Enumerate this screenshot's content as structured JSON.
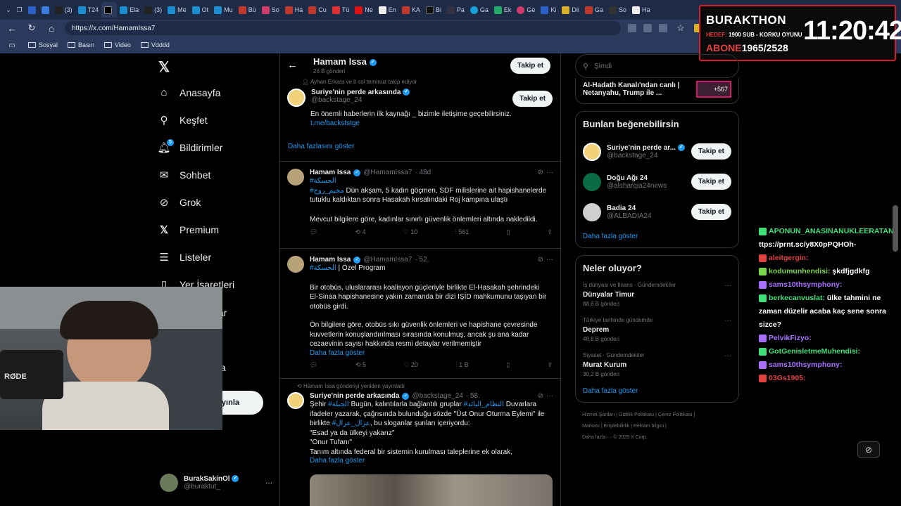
{
  "browser": {
    "tabs": [
      "(3)",
      "T24",
      "",
      "Ela",
      "(3)",
      "Me",
      "Ot",
      "Mu",
      "Bü",
      "So",
      "Ha",
      "Cu",
      "Tü",
      "Ne",
      "En",
      "KA",
      "Bi",
      "Pa",
      "Ga",
      "Ek",
      "Ge",
      "Ki",
      "Dii",
      "Ga",
      "So",
      "Ha"
    ],
    "url": "https://x.com/HamamIssa7",
    "bookmarks": [
      "Sosyal",
      "Basın",
      "Video",
      "Vdddd"
    ]
  },
  "stream": {
    "name": "BURAKTHON",
    "hedef_label": "HEDEF:",
    "hedef": "1900 SUB - KORKU OYUNU",
    "abone_label": "ABONE",
    "abone": "1965/2528",
    "clock": "11:20:42"
  },
  "nav": {
    "items": [
      {
        "label": "Anasayfa",
        "icon": "home-icon"
      },
      {
        "label": "Keşfet",
        "icon": "search-icon"
      },
      {
        "label": "Bildirimler",
        "icon": "bell-icon",
        "badge": "5"
      },
      {
        "label": "Sohbet",
        "icon": "mail-icon"
      },
      {
        "label": "Grok",
        "icon": "grok-icon"
      },
      {
        "label": "Premium",
        "icon": "x-icon"
      },
      {
        "label": "Listeler",
        "icon": "list-icon"
      },
      {
        "label": "Yer İşaretleri",
        "icon": "bookmark-icon"
      }
    ],
    "partial_1": "ar",
    "partial_2": "a",
    "post_button": "ıyınla",
    "account": {
      "name": "BurakSakinOl",
      "handle": "@buraktut_"
    }
  },
  "profile": {
    "name": "Hamam Issa",
    "posts": "26 B gönderi",
    "follow": "Takip et"
  },
  "follow_suggestion": {
    "context": "Ayhan Erkara ve lt col temmuz takip ediyor",
    "name": "Suriye'nin perde arkasında",
    "handle": "@backstage_24",
    "bio": "En önemli haberlerin ilk kaynağı _ bizimle iletişime geçebilirsiniz.",
    "link": "t.me/backststge",
    "show_more": "Daha fazlasını göster",
    "follow": "Takip et"
  },
  "tweets": [
    {
      "name": "Hamam Issa",
      "handle": "@HamamIssa7",
      "time": "· 48d",
      "hash1": "#الحسكة",
      "hash2": "#مخيم_روج",
      "line1": "Dün akşam, 5 kadın göçmen, SDF milislerine ait hapishanelerde",
      "line2": "tutuklu kaldıktan sonra Hasakah kırsalındaki Roj kampına ulaştı",
      "line3": "Mevcut bilgilere göre, kadınlar sınırlı güvenlik önlemleri altında nakledildi.",
      "stats": {
        "reply": "",
        "retweet": "4",
        "like": "10",
        "views": "561"
      }
    },
    {
      "name": "Hamam Issa",
      "handle": "@HamamIssa7",
      "time": "· 52.",
      "hash1": "#الحسكة",
      "title": "| Özel Program",
      "p1a": "Bir otobüs, uluslararası koalisyon güçleriyle birlikte El-Hasakah şehrindeki",
      "p1b": "El-Sinaa hapishanesine yakın zamanda bir dizi IŞİD mahkumunu taşıyan bir",
      "p1c": "otobüs girdi.",
      "p2a": "Ön bilgilere göre, otobüs sıkı güvenlik önlemleri ve hapishane çevresinde",
      "p2b": "kuvvetlerin konuşlandırılması sırasında konulmuş, ancak şu ana kadar",
      "p2c": "cezaevinin sayısı hakkında resmi detaylar verilmemiştir",
      "more": "Daha fazla göster",
      "stats": {
        "reply": "",
        "retweet": "5",
        "like": "20",
        "views": "1 B"
      }
    },
    {
      "repost": "Hamam Issa gönderiyi yeniden yayınladı",
      "name": "Suriye'nin perde arkasında",
      "handle": "@backstage_24",
      "time": "· 58.",
      "l1a": "Şehir",
      "l1h1": "#الجبلة",
      "l1b": "Bugün, kalıntılarla bağlantılı gruplar",
      "l1h2": "#النظام_البائد",
      "l1c": "Duvarlara",
      "l2": "ifadeler yazarak, çağrısında bulunduğu sözde \"Üst Onur Oturma Eylemi\" ile",
      "l3a": "birlikte",
      "l3h": "#عزال_عزال",
      "l3b": ", bu sloganlar şunları içeriyordu:",
      "l4": "\"Esad ya da ülkeyi yakarız\"",
      "l5": "\"Onur Tufanı\"",
      "l6": "Tanım altında federal bir sistemin kurulması taleplerine ek olarak,",
      "more": "Daha fazla göster"
    }
  ],
  "right": {
    "search_placeholder": "Şimdi",
    "live": {
      "line1": "Al-Hadath Kanalı'ndan canlı |",
      "line2": "Netanyahu, Trump ile ...",
      "count": "+567"
    },
    "suggest_title": "Bunları beğenebilirsin",
    "suggestions": [
      {
        "name": "Suriye'nin perde ar...",
        "handle": "@backstage_24",
        "follow": "Takip et"
      },
      {
        "name": "Doğu Ağı 24",
        "handle": "@alsharqia24news",
        "follow": "Takip et"
      },
      {
        "name": "Badia 24",
        "handle": "@ALBADIA24",
        "follow": "Takip et"
      }
    ],
    "suggest_more": "Daha fazla göster",
    "trends_title": "Neler oluyor?",
    "trends": [
      {
        "meta": "İş dünyası ve finans · Gündemdekiler",
        "topic": "Dünyalar Timur",
        "count": "88,6 B gönderi"
      },
      {
        "meta": "Türkiye tarihinde gündemde",
        "topic": "Deprem",
        "count": "48,8 B gönderi"
      },
      {
        "meta": "Siyaset · Gündemdekiler",
        "topic": "Murat Kurum",
        "count": "30,2 B gönderi"
      }
    ],
    "trends_more": "Daha fazla göster",
    "footer1": "Hizmet Şartları | Gizlilik Politikası | Çerez Politikası |",
    "footer2": "Markası | Erişilebilirlik | Reklam bilgisi |",
    "footer3": "Daha fazla ··· © 2025 X Corp."
  },
  "chat": [
    {
      "user": "APONUN_ANASINANUKLEERATAN:",
      "msg": "ttps://prnt.sc/y8X0pPQHOh-",
      "color": "#3ee07a"
    },
    {
      "user": "aleitgergin:",
      "msg": "",
      "color": "#e0413e"
    },
    {
      "user": "kodumunhendisi:",
      "msg": "şkdfjgdkfg",
      "color": "#7ad548"
    },
    {
      "user": "sams10thsymphony:",
      "msg": "",
      "color": "#a970ff"
    },
    {
      "user": "berkecanvuslat:",
      "msg": "ülke tahmini ne zaman düzelir acaba kaç sene sonra sizce?",
      "color": "#3ee07a"
    },
    {
      "user": "PelvikFizyo:",
      "msg": "",
      "color": "#a970ff"
    },
    {
      "user": "GotGenisletmeMuhendisi:",
      "msg": "",
      "color": "#3ee07a"
    },
    {
      "user": "sams10thsymphony:",
      "msg": "",
      "color": "#a970ff"
    },
    {
      "user": "03Gs1905:",
      "msg": "",
      "color": "#e0413e"
    }
  ],
  "webcam": {
    "mic_label": "RØDE"
  }
}
